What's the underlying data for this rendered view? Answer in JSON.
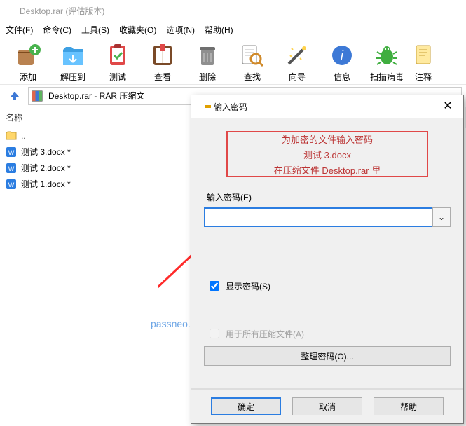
{
  "window": {
    "title": "Desktop.rar (评估版本)"
  },
  "menu": {
    "file": "文件(F)",
    "cmd": "命令(C)",
    "tool": "工具(S)",
    "fav": "收藏夹(O)",
    "opt": "选项(N)",
    "help": "帮助(H)"
  },
  "toolbar": {
    "add": "添加",
    "extract": "解压到",
    "test": "测试",
    "view": "查看",
    "delete": "删除",
    "find": "查找",
    "wizard": "向导",
    "info": "信息",
    "scan": "扫描病毒",
    "comment": "注释"
  },
  "pathbar": {
    "up": "↑",
    "path": "Desktop.rar - RAR 压缩文"
  },
  "list": {
    "header_name": "名称",
    "rows": [
      {
        "name": "..",
        "modified": false
      },
      {
        "name": "测试 3.docx *",
        "modified": true
      },
      {
        "name": "测试 2.docx *",
        "modified": true
      },
      {
        "name": "测试 1.docx *",
        "modified": true
      }
    ]
  },
  "watermark": "passneo.cn",
  "dialog": {
    "title": "输入密码",
    "info1": "为加密的文件输入密码",
    "info2": "测试 3.docx",
    "info3": "在压缩文件 Desktop.rar 里",
    "pwd_label": "输入密码(E)",
    "pwd_value": "",
    "show_pwd": "显示密码(S)",
    "for_all": "用于所有压缩文件(A)",
    "organize": "整理密码(O)...",
    "ok": "确定",
    "cancel": "取消",
    "help": "帮助",
    "close": "✕",
    "dropdown": "⌄"
  }
}
